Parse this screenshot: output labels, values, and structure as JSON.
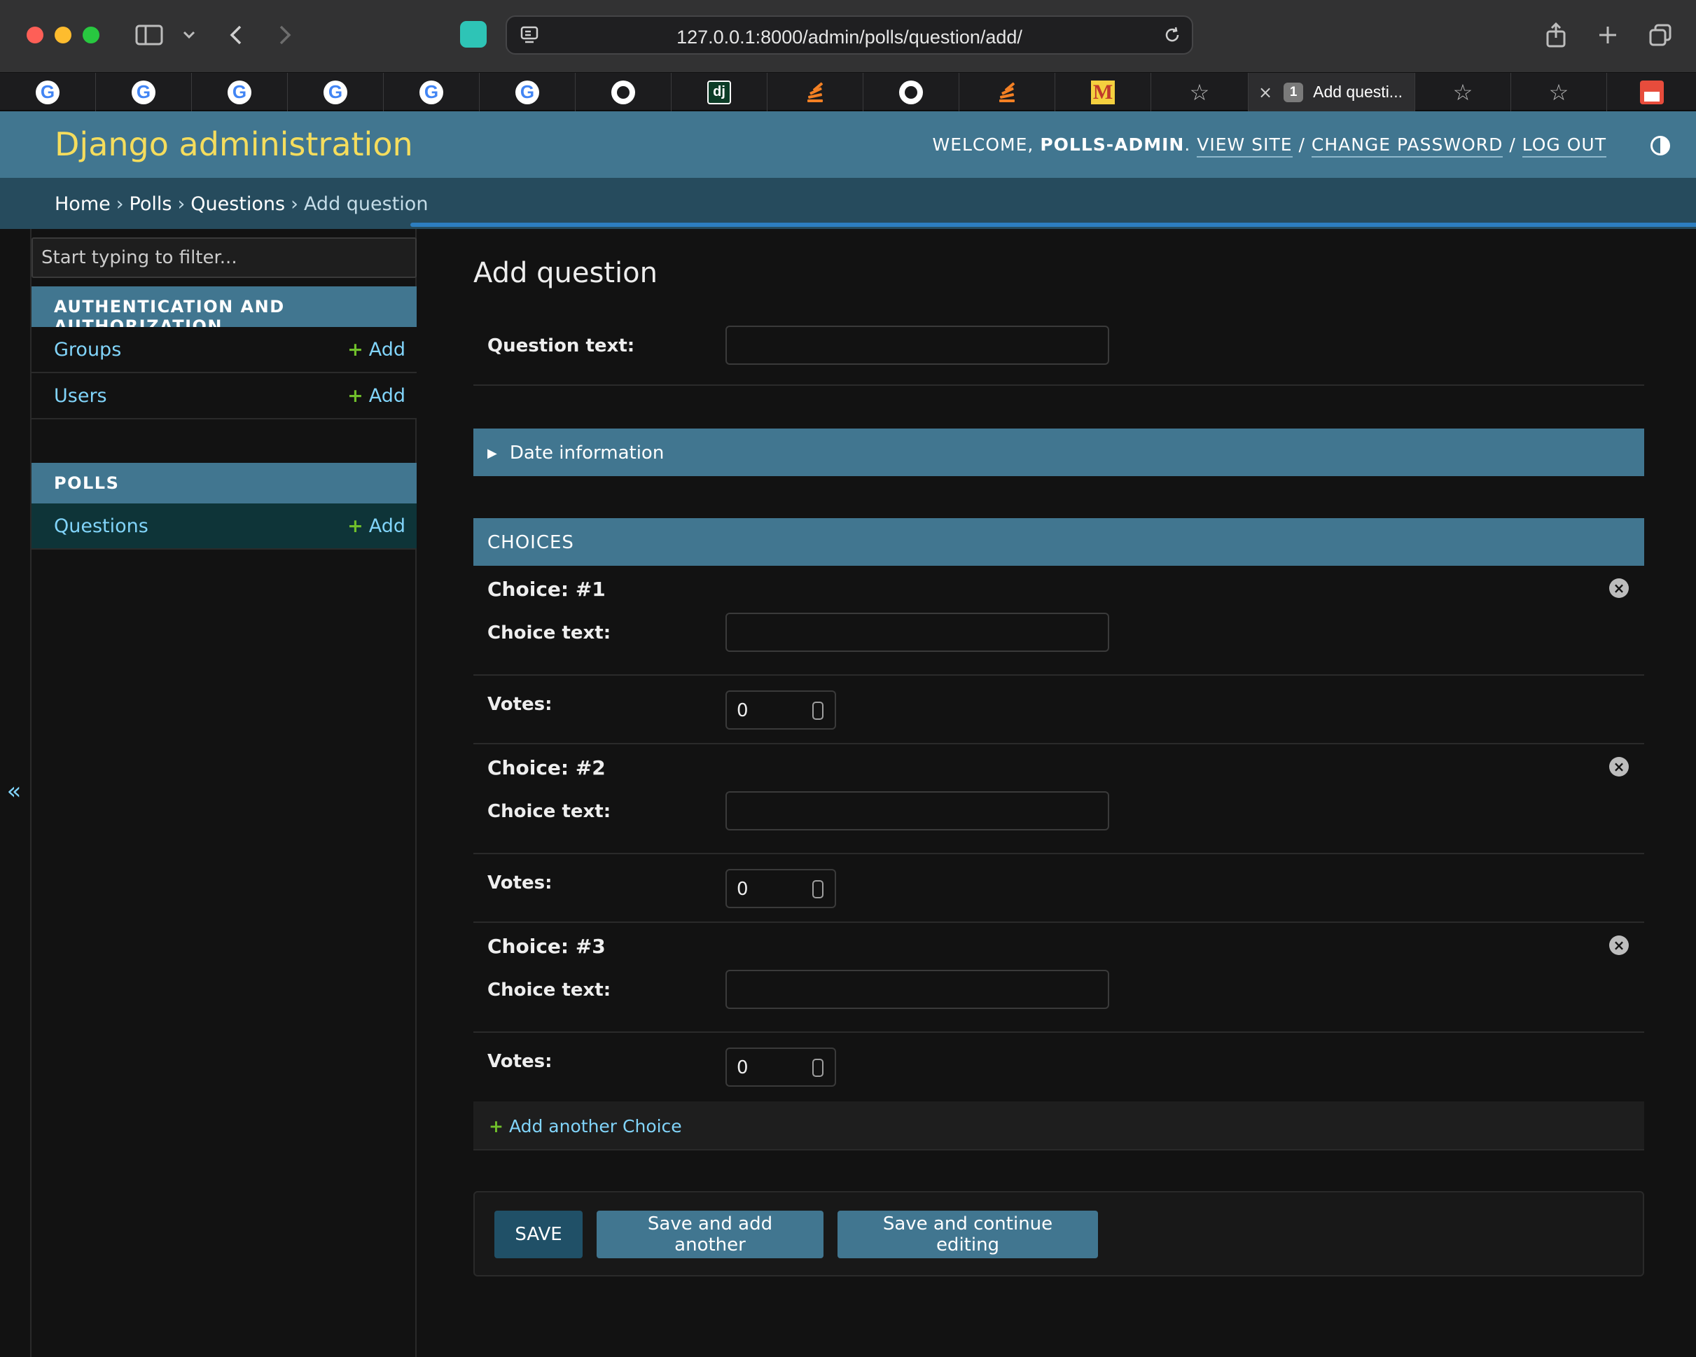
{
  "browser": {
    "url": "127.0.0.1:8000/admin/polls/question/add/",
    "active_tab": {
      "number": "1",
      "title": "Add questi..."
    },
    "pinned_tabs": [
      "google",
      "google",
      "google",
      "google",
      "google",
      "google",
      "github",
      "django",
      "stackoverflow",
      "github",
      "stackoverflow",
      "m-logo",
      "star",
      "star",
      "star",
      "gift"
    ],
    "close_glyph": "×",
    "star_glyph": "☆"
  },
  "header": {
    "branding": "Django administration",
    "welcome": "WELCOME,",
    "username": "POLLS-ADMIN",
    "view_site": "VIEW SITE",
    "change_password": "CHANGE PASSWORD",
    "log_out": "LOG OUT",
    "separator": "/"
  },
  "breadcrumbs": {
    "items": [
      "Home",
      "Polls",
      "Questions",
      "Add question"
    ],
    "separator": "›"
  },
  "sidebar": {
    "filter_placeholder": "Start typing to filter...",
    "toggle_glyph": "«",
    "apps": [
      {
        "caption": "AUTHENTICATION AND AUTHORIZATION",
        "models": [
          {
            "name": "Groups",
            "add": "Add"
          },
          {
            "name": "Users",
            "add": "Add"
          }
        ]
      },
      {
        "caption": "POLLS",
        "models": [
          {
            "name": "Questions",
            "add": "Add",
            "current": true
          }
        ]
      }
    ],
    "plus_glyph": "+"
  },
  "form": {
    "title": "Add question",
    "question_text_label": "Question text:",
    "question_text_value": "",
    "date_fieldset": "Date information",
    "collapse_glyph": "▶",
    "choices_caption": "CHOICES",
    "choices": [
      {
        "title": "Choice: #1",
        "choice_text_label": "Choice text:",
        "choice_text_value": "",
        "votes_label": "Votes:",
        "votes_value": "0"
      },
      {
        "title": "Choice: #2",
        "choice_text_label": "Choice text:",
        "choice_text_value": "",
        "votes_label": "Votes:",
        "votes_value": "0"
      },
      {
        "title": "Choice: #3",
        "choice_text_label": "Choice text:",
        "choice_text_value": "",
        "votes_label": "Votes:",
        "votes_value": "0"
      }
    ],
    "delete_glyph": "×",
    "add_another": "Add another Choice"
  },
  "submit": {
    "save": "SAVE",
    "save_add_another": "Save and add another",
    "save_continue": "Save and continue editing"
  },
  "colors": {
    "header_bg": "#417690",
    "breadcrumbs_bg": "#264b5d",
    "branding": "#f5dd5d",
    "link": "#81d4fa",
    "add_plus": "#70bf2b",
    "default_button": "#205067",
    "page_bg": "#121212"
  }
}
